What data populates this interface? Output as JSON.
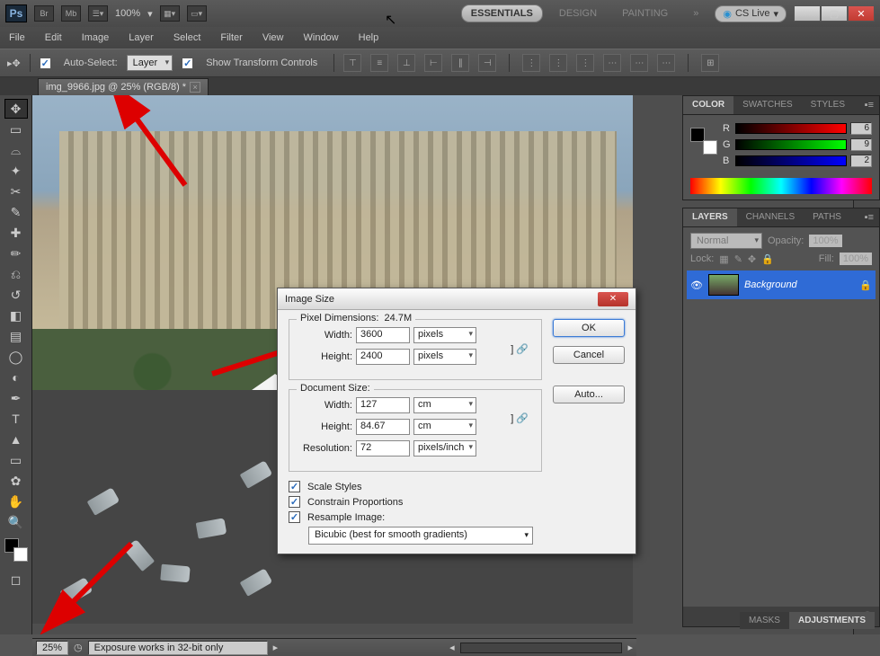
{
  "appbar": {
    "zoom": "100%",
    "workspaces": [
      "ESSENTIALS",
      "DESIGN",
      "PAINTING"
    ],
    "more": "»",
    "cslive": "CS Live"
  },
  "menu": [
    "File",
    "Edit",
    "Image",
    "Layer",
    "Select",
    "Filter",
    "View",
    "Window",
    "Help"
  ],
  "optbar": {
    "auto_select": "Auto-Select:",
    "layer": "Layer",
    "show_transform": "Show Transform Controls"
  },
  "tab": {
    "title": "img_9966.jpg @ 25% (RGB/8) *"
  },
  "status": {
    "zoom": "25%",
    "info": "Exposure works in 32-bit only"
  },
  "color_panel": {
    "tabs": [
      "COLOR",
      "SWATCHES",
      "STYLES"
    ],
    "r": "6",
    "g": "9",
    "b": "2"
  },
  "layers_panel": {
    "tabs": [
      "LAYERS",
      "CHANNELS",
      "PATHS"
    ],
    "blend": "Normal",
    "opacity_label": "Opacity:",
    "opacity_val": "100%",
    "lock_label": "Lock:",
    "fill_label": "Fill:",
    "fill_val": "100%",
    "layer_name": "Background"
  },
  "bottom_tabs": [
    "MASKS",
    "ADJUSTMENTS"
  ],
  "dialog": {
    "title": "Image Size",
    "ok": "OK",
    "cancel": "Cancel",
    "auto": "Auto...",
    "pixel_legend": "Pixel Dimensions:",
    "pixel_size": "24.7M",
    "doc_legend": "Document Size:",
    "width_label": "Width:",
    "height_label": "Height:",
    "res_label": "Resolution:",
    "px_w": "3600",
    "px_h": "2400",
    "px_unit": "pixels",
    "doc_w": "127",
    "doc_h": "84.67",
    "doc_unit": "cm",
    "res": "72",
    "res_unit": "pixels/inch",
    "scale_styles": "Scale Styles",
    "constrain": "Constrain Proportions",
    "resample": "Resample Image:",
    "interpolation": "Bicubic (best for smooth gradients)"
  }
}
